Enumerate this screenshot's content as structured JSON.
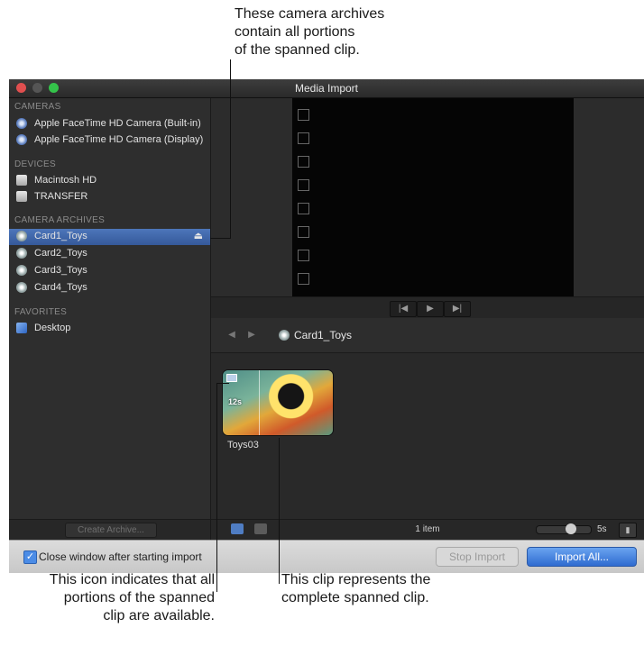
{
  "callouts": {
    "top": [
      "These camera archives",
      "contain all portions",
      "of the spanned clip."
    ],
    "bottom_left": [
      "This icon indicates that all",
      "portions of the spanned",
      "clip are available."
    ],
    "bottom_right": [
      "This clip represents the",
      "complete spanned clip."
    ]
  },
  "window": {
    "title": "Media Import"
  },
  "sidebar": {
    "cameras_header": "CAMERAS",
    "cameras": [
      "Apple FaceTime HD Camera (Built-in)",
      "Apple FaceTime HD Camera (Display)"
    ],
    "devices_header": "DEVICES",
    "devices": [
      "Macintosh HD",
      "TRANSFER"
    ],
    "archives_header": "CAMERA ARCHIVES",
    "archives": [
      "Card1_Toys",
      "Card2_Toys",
      "Card3_Toys",
      "Card4_Toys"
    ],
    "favorites_header": "FAVORITES",
    "favorites": [
      "Desktop"
    ],
    "eject_glyph": "⏏",
    "create_archive": "Create Archive..."
  },
  "browser": {
    "breadcrumb": "Card1_Toys",
    "clip": {
      "name": "Toys03",
      "duration": "12s"
    },
    "item_count": "1 item",
    "zoom_value": "5s"
  },
  "footer": {
    "close_checkbox_label": "Close window after starting import",
    "close_checked": true,
    "stop_import": "Stop Import",
    "import_all": "Import All..."
  },
  "icons": {
    "camera": "camera-icon",
    "drive": "drive-icon",
    "archive": "archive-icon",
    "desktop": "desktop-icon"
  }
}
